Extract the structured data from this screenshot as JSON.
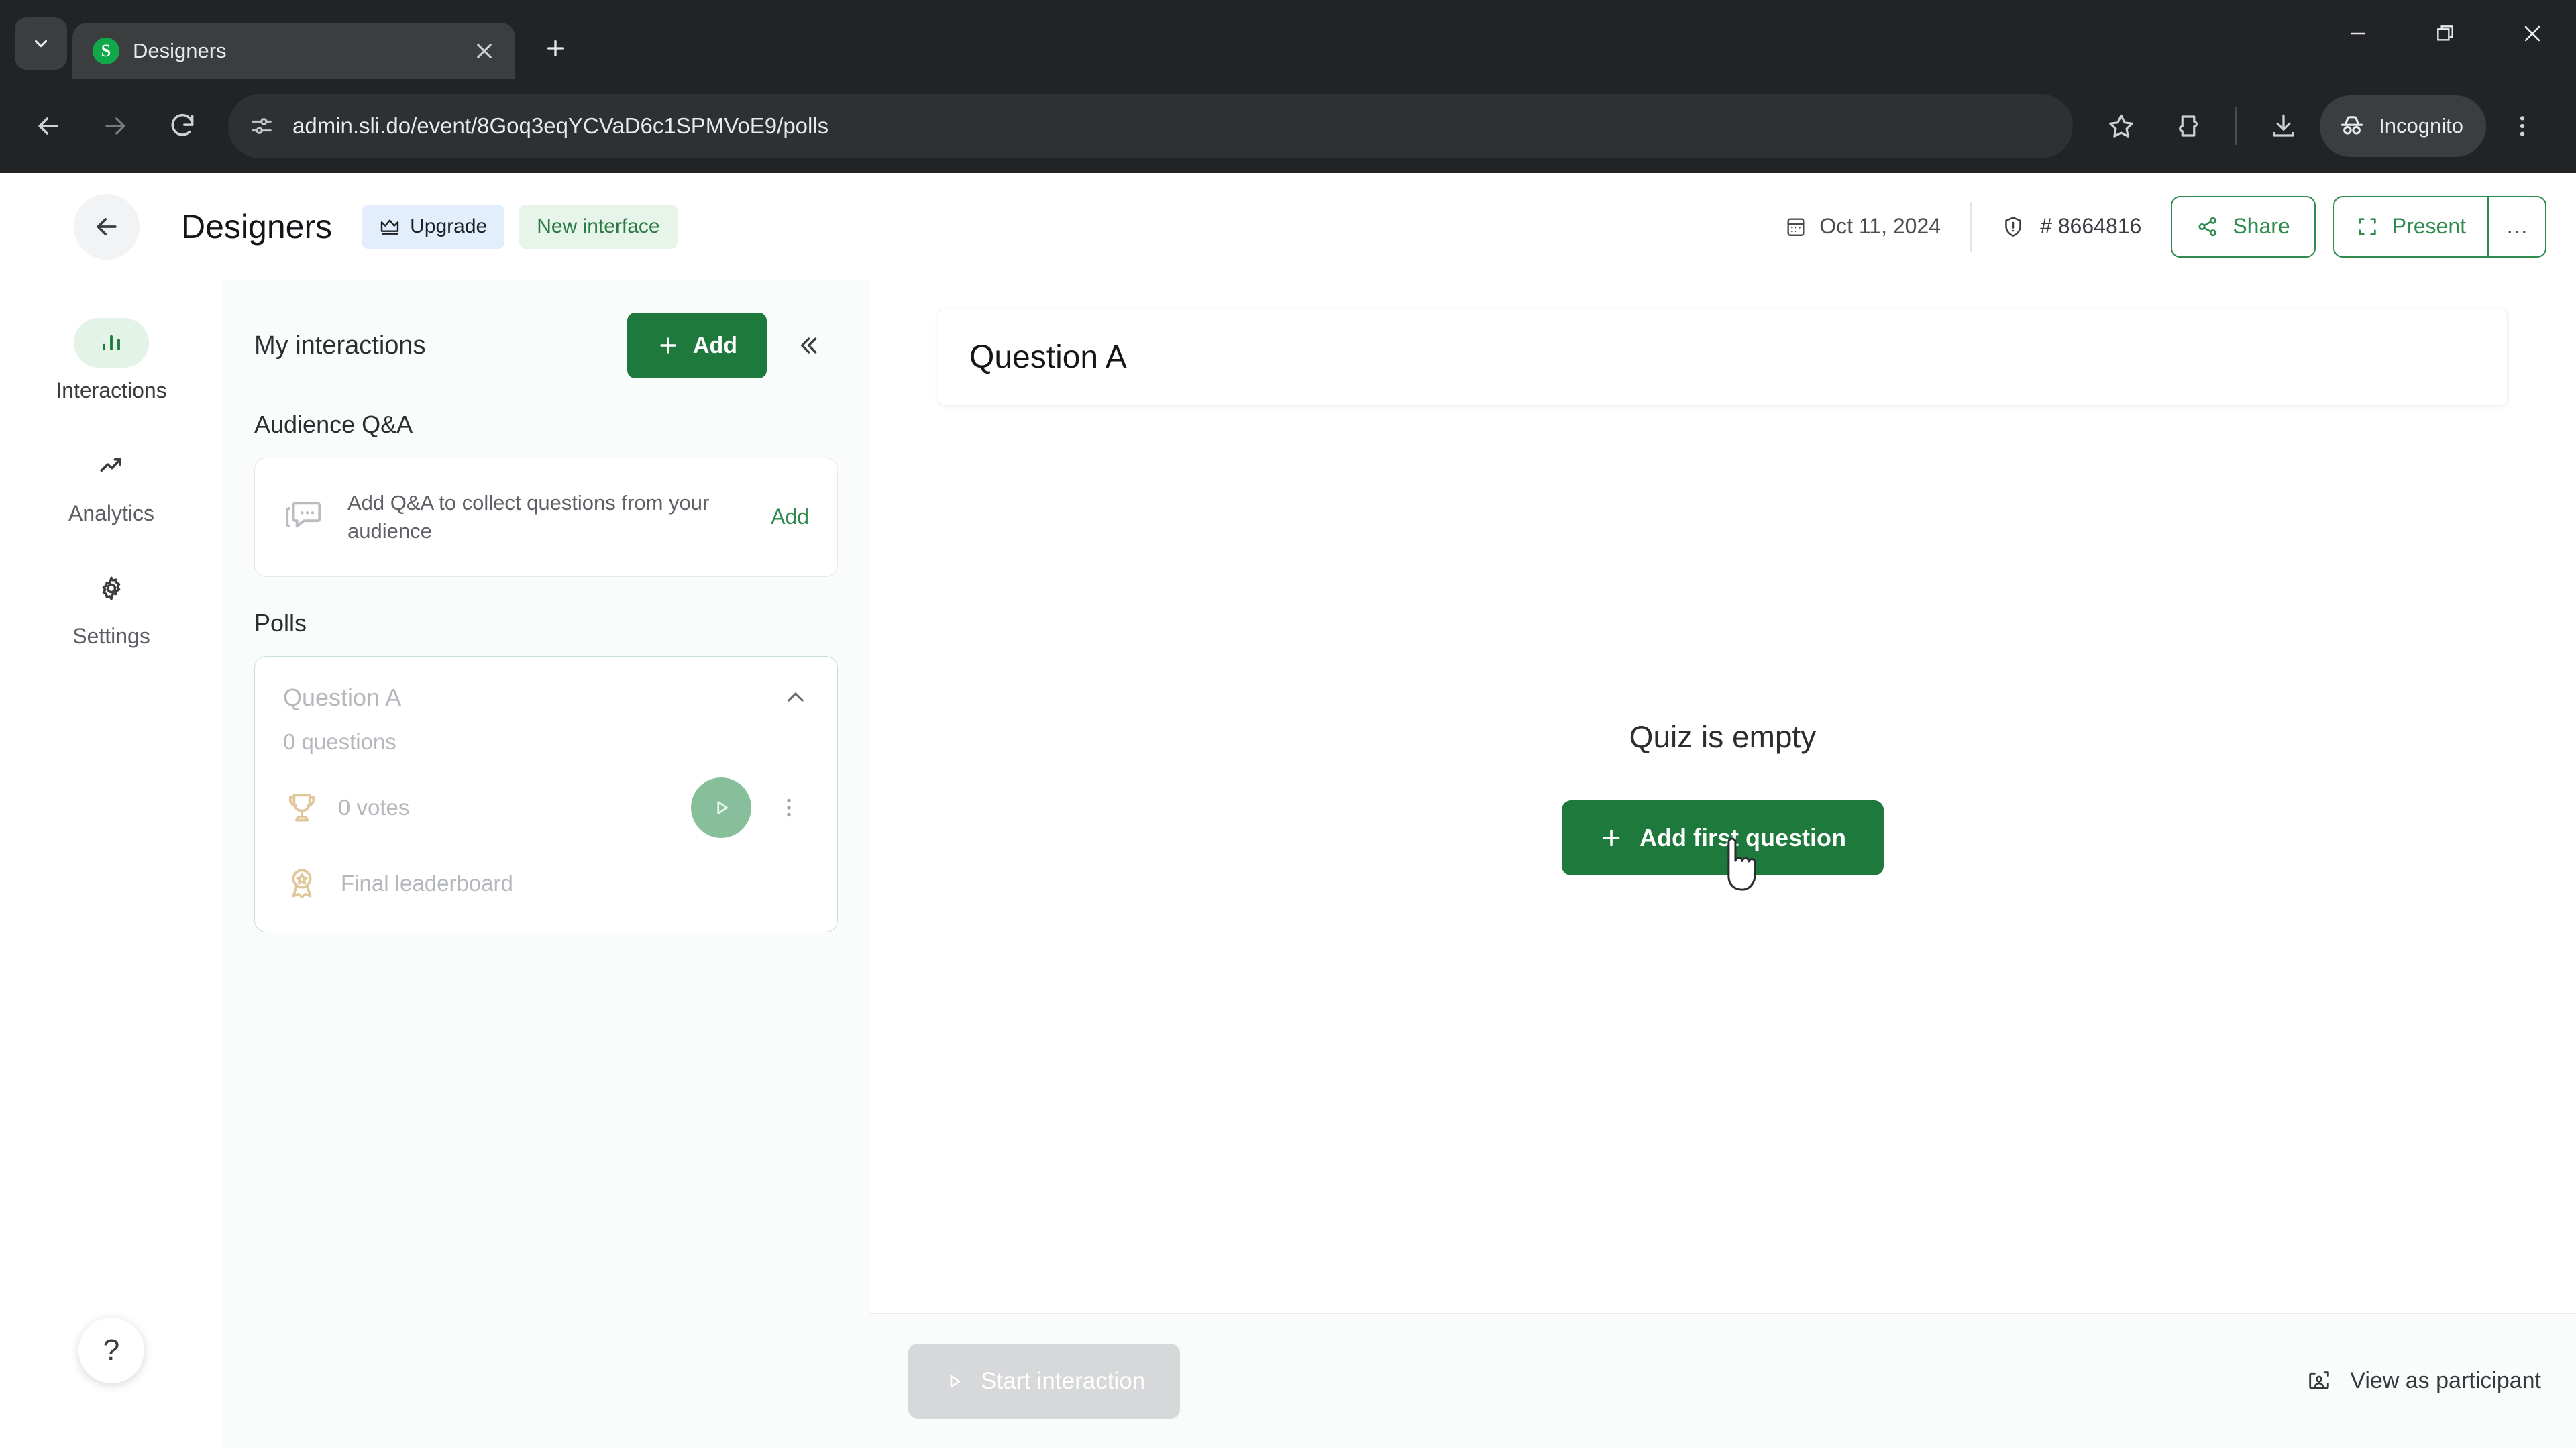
{
  "browser": {
    "tab": {
      "title": "Designers",
      "favicon_letter": "S",
      "favicon_color": "#11a84c"
    },
    "new_tab_label": "+",
    "window_controls": {
      "minimize": "minimize-icon",
      "maximize": "maximize-icon",
      "close": "close-icon"
    },
    "toolbar": {
      "back": "back-arrow-icon",
      "forward": "forward-arrow-icon",
      "reload": "reload-icon",
      "site_info": "site-settings-icon",
      "url": "admin.sli.do/event/8Goq3eqYCVaD6c1SPMVoE9/polls",
      "bookmark": "star-icon",
      "extensions": "extensions-icon",
      "downloads": "download-icon",
      "profile_label": "Incognito",
      "menu": "three-dot-menu-icon"
    }
  },
  "header": {
    "back_label": "back-arrow",
    "event_title": "Designers",
    "upgrade_label": "Upgrade",
    "new_interface_label": "New interface",
    "date": "Oct 11, 2024",
    "event_code": "# 8664816",
    "share_label": "Share",
    "present_label": "Present",
    "more_label": "…"
  },
  "rail": {
    "items": [
      {
        "label": "Interactions",
        "icon": "bar-chart-icon",
        "active": true
      },
      {
        "label": "Analytics",
        "icon": "trending-up-icon",
        "active": false
      },
      {
        "label": "Settings",
        "icon": "gear-icon",
        "active": false
      }
    ],
    "help_label": "?"
  },
  "panel": {
    "title": "My interactions",
    "add_label": "Add",
    "collapse_label": "«",
    "qa_section_label": "Audience Q&A",
    "qa_card": {
      "description": "Add Q&A to collect questions from your audience",
      "add_label": "Add",
      "icon": "chat-bubbles-icon"
    },
    "polls_section_label": "Polls",
    "poll_card": {
      "name": "Question A",
      "subtitle": "0 questions",
      "votes": "0 votes",
      "leaderboard_label": "Final leaderboard",
      "trophy_icon": "trophy-icon",
      "leaderboard_icon": "award-medal-icon",
      "play_icon": "play-icon",
      "kebab_icon": "three-dot-menu-icon",
      "chevron_icon": "chevron-up-icon"
    }
  },
  "main": {
    "question_title": "Question A",
    "empty_title": "Quiz is empty",
    "add_first_label": "Add first question",
    "start_interaction_label": "Start interaction",
    "view_as_participant_label": "View as participant"
  },
  "colors": {
    "brand_green": "#1e7a3c",
    "accent_green": "#2f8a4e",
    "panel_bg": "#fafbfb",
    "chrome_bg": "#222324",
    "upgrade_bg": "#e2eefb",
    "newui_bg": "#e7f4ea"
  }
}
